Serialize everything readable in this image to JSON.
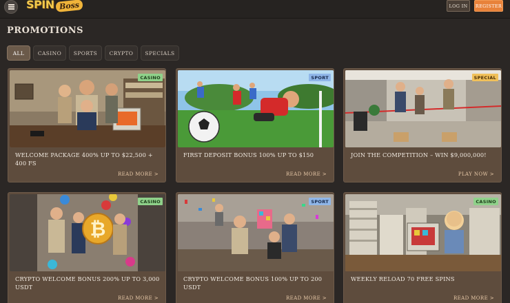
{
  "header": {
    "logo_main": "SPIN",
    "logo_sub": "Boss",
    "login_label": "LOG IN",
    "register_label": "REGISTER"
  },
  "page_title": "PROMOTIONS",
  "filters": [
    "ALL",
    "CASINO",
    "SPORTS",
    "CRYPTO",
    "SPECIALS"
  ],
  "active_filter": "ALL",
  "colors": {
    "background": "#2b2725",
    "card": "#5e4c3d",
    "register": "#e8823a",
    "tag_casino": "#8fd18a",
    "tag_sport": "#8fb6e8",
    "tag_special": "#f0c05a"
  },
  "cards": [
    {
      "tag": "CASINO",
      "title": "WELCOME PACKAGE 400% UP TO $22,500 + 400 FS",
      "link": "READ MORE >"
    },
    {
      "tag": "SPORT",
      "title": "FIRST DEPOSIT BONUS 100% UP TO $150",
      "link": "READ MORE >"
    },
    {
      "tag": "SPECIAL",
      "title": "JOIN THE COMPETITION – WIN $9,000,000!",
      "link": "PLAY NOW >"
    },
    {
      "tag": "CASINO",
      "title": "CRYPTO WELCOME BONUS 200% UP TO 3,000 USDT",
      "link": "READ MORE >"
    },
    {
      "tag": "SPORT",
      "title": "CRYPTO WELCOME BONUS 100% UP TO 200 USDT",
      "link": "READ MORE >"
    },
    {
      "tag": "CASINO",
      "title": "WEEKLY RELOAD 70 FREE SPINS",
      "link": "READ MORE >"
    }
  ]
}
